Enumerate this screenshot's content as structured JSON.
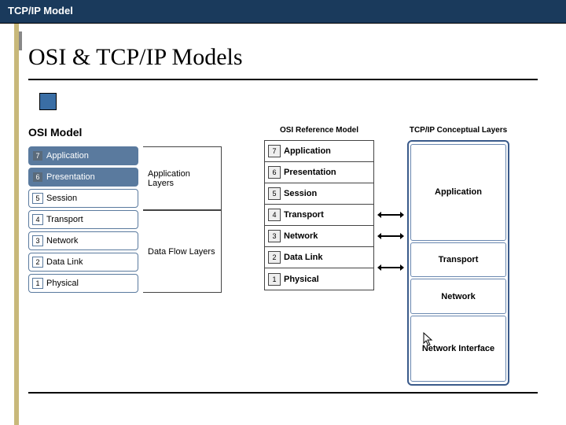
{
  "header": {
    "title": "TCP/IP Model"
  },
  "slide": {
    "title": "OSI & TCP/IP Models"
  },
  "left_diagram": {
    "title": "OSI Model",
    "layers": [
      {
        "num": "7",
        "name": "Application"
      },
      {
        "num": "6",
        "name": "Presentation"
      },
      {
        "num": "5",
        "name": "Session"
      },
      {
        "num": "4",
        "name": "Transport"
      },
      {
        "num": "3",
        "name": "Network"
      },
      {
        "num": "2",
        "name": "Data Link"
      },
      {
        "num": "1",
        "name": "Physical"
      }
    ],
    "groups": [
      {
        "label": "Application Layers"
      },
      {
        "label": "Data Flow Layers"
      }
    ]
  },
  "right_diagram": {
    "osi_header": "OSI Reference Model",
    "tcp_header": "TCP/IP Conceptual Layers",
    "osi_layers": [
      {
        "num": "7",
        "name": "Application"
      },
      {
        "num": "6",
        "name": "Presentation"
      },
      {
        "num": "5",
        "name": "Session"
      },
      {
        "num": "4",
        "name": "Transport"
      },
      {
        "num": "3",
        "name": "Network"
      },
      {
        "num": "2",
        "name": "Data Link"
      },
      {
        "num": "1",
        "name": "Physical"
      }
    ],
    "tcp_layers": [
      {
        "name": "Application"
      },
      {
        "name": "Transport"
      },
      {
        "name": "Network"
      },
      {
        "name": "Network Interface"
      }
    ]
  }
}
